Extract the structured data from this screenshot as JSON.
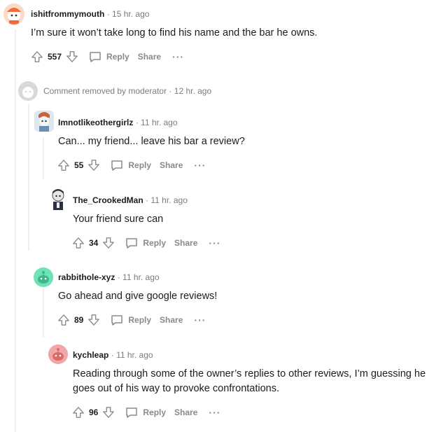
{
  "comments": [
    {
      "username": "ishitfrommymouth",
      "time": "15 hr. ago",
      "body": "I’m sure it won’t take long to find his name and the bar he owns.",
      "score": "557",
      "reply_label": "Reply",
      "share_label": "Share",
      "more_label": "···",
      "avatar_color": "#f26b3a"
    },
    {
      "removed_text": "Comment removed by moderator",
      "time": "12 hr. ago",
      "avatar_color": "#d7dadc"
    },
    {
      "username": "Imnotlikeothergirlz",
      "time": "11 hr. ago",
      "body": "Can... my friend... leave his bar a review?",
      "score": "55",
      "reply_label": "Reply",
      "share_label": "Share",
      "more_label": "···",
      "avatar_color": "#a9c3d6"
    },
    {
      "username": "The_CrookedMan",
      "time": "11 hr. ago",
      "body": "Your friend sure can",
      "score": "34",
      "reply_label": "Reply",
      "share_label": "Share",
      "more_label": "···",
      "avatar_color": "#e8e8e8"
    },
    {
      "username": "rabbithole-xyz",
      "time": "11 hr. ago",
      "body": "Go ahead and give google reviews!",
      "score": "89",
      "reply_label": "Reply",
      "share_label": "Share",
      "more_label": "···",
      "avatar_color": "#6ee3b5"
    },
    {
      "username": "kychleap",
      "time": "11 hr. ago",
      "body": "Reading through some of the owner’s replies to other reviews, I’m guessing he goes out of his way to provoke confrontations.",
      "score": "96",
      "reply_label": "Reply",
      "share_label": "Share",
      "more_label": "···",
      "avatar_color": "#f1a7a7"
    }
  ],
  "separator": "·",
  "colors": {
    "meta_gray": "#7c7c7c",
    "action_gray": "#878a8c",
    "thread_line": "#edeff1"
  }
}
